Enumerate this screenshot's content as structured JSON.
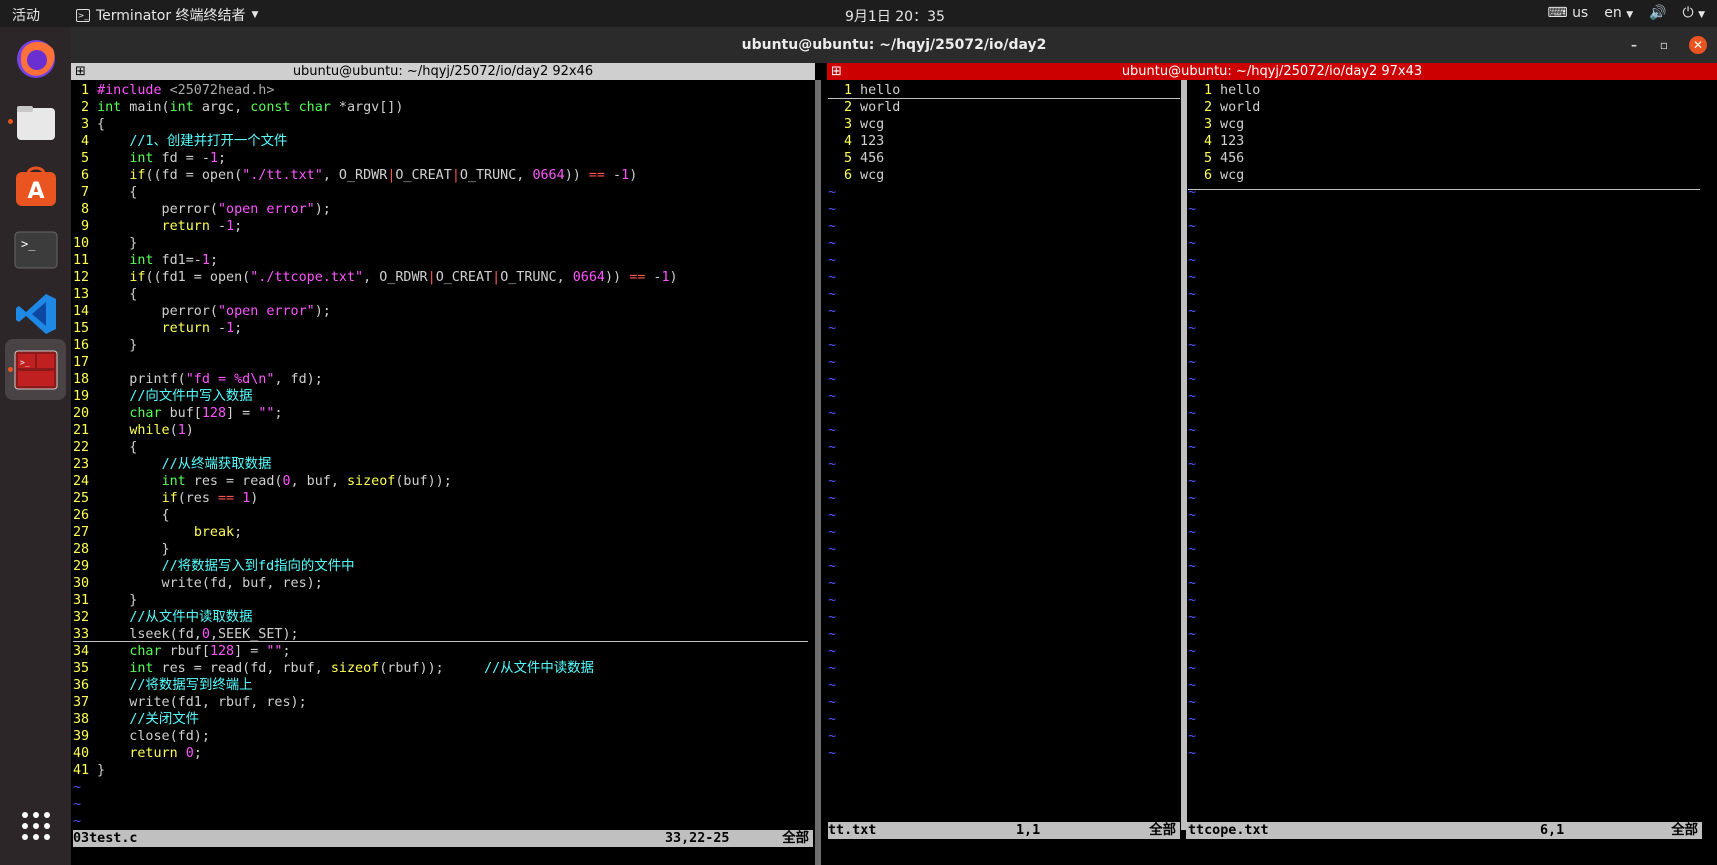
{
  "topbar": {
    "activities": "活动",
    "app_name": "Terminator 终端终结者",
    "clock": "9月1日  20：35",
    "keyboard": "us",
    "lang": "en"
  },
  "dock": {
    "items": [
      "firefox-icon",
      "files-icon",
      "software-icon",
      "terminal-icon",
      "vscode-icon",
      "terminator-icon"
    ]
  },
  "window": {
    "title": "ubuntu@ubuntu: ~/hqyj/25072/io/day2"
  },
  "left_pane": {
    "title": "ubuntu@ubuntu: ~/hqyj/25072/io/day2 92x46",
    "status_file": "03test.c",
    "status_pos": "33,22-25",
    "status_all": "全部",
    "code": [
      "#include <25072head.h>",
      "int main(int argc, const char *argv[])",
      "{",
      "    //1、创建并打开一个文件",
      "    int fd = -1;",
      "    if((fd = open(\"./tt.txt\", O_RDWR|O_CREAT|O_TRUNC, 0664)) == -1)",
      "    {",
      "        perror(\"open error\");",
      "        return -1;",
      "    }",
      "    int fd1=-1;",
      "    if((fd1 = open(\"./ttcope.txt\", O_RDWR|O_CREAT|O_TRUNC, 0664)) == -1)",
      "    {",
      "        perror(\"open error\");",
      "        return -1;",
      "    }",
      "",
      "    printf(\"fd = %d\\n\", fd);",
      "    //向文件中写入数据",
      "    char buf[128] = \"\";",
      "    while(1)",
      "    {",
      "        //从终端获取数据",
      "        int res = read(0, buf, sizeof(buf));",
      "        if(res == 1)",
      "        {",
      "            break;",
      "        }",
      "        //将数据写入到fd指向的文件中",
      "        write(fd, buf, res);",
      "    }",
      "    //从文件中读取数据",
      "    lseek(fd,0,SEEK_SET);",
      "    char rbuf[128] = \"\";",
      "    int res = read(fd, rbuf, sizeof(rbuf));     //从文件中读数据",
      "    //将数据写到终端上",
      "    write(fd1, rbuf, res);",
      "    //关闭文件",
      "    close(fd);",
      "    return 0;",
      "}"
    ]
  },
  "right_pane": {
    "title": "ubuntu@ubuntu: ~/hqyj/25072/io/day2 97x43",
    "left_split": {
      "lines": [
        "hello",
        "world",
        "wcg",
        "123",
        "456",
        "wcg"
      ],
      "status_file": "tt.txt",
      "status_pos": "1,1",
      "status_all": "全部"
    },
    "right_split": {
      "lines": [
        "hello",
        "world",
        "wcg",
        "123",
        "456",
        "wcg"
      ],
      "status_file": "ttcope.txt",
      "status_pos": "6,1",
      "status_all": "全部"
    }
  }
}
